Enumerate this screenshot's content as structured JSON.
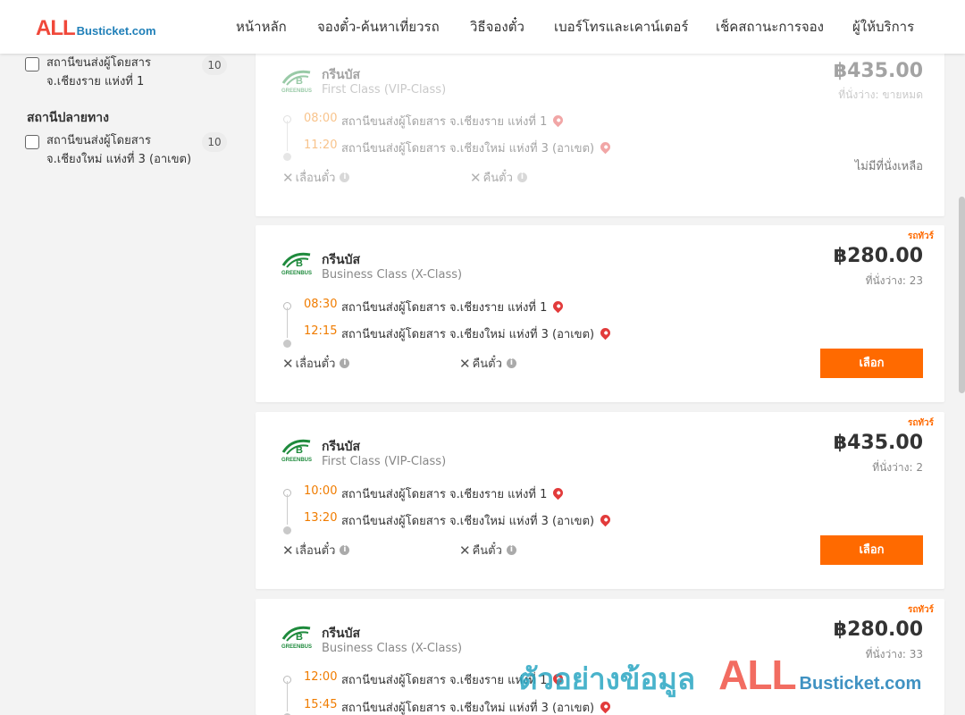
{
  "header": {
    "logo_all": "ALL",
    "logo_busticket": "Busticket.com",
    "nav": [
      "หน้าหลัก",
      "จองตั๋ว-ค้นหาเที่ยวรถ",
      "วิธีจองตั๋ว",
      "เบอร์โทรและเคาน์เตอร์",
      "เช็คสถานะการจอง",
      "ผู้ให้บริการ"
    ]
  },
  "sidebar": {
    "origin_item": {
      "label": "สถานีขนส่งผู้โดยสาร จ.เชียงราย แห่งที่ 1",
      "count": "10"
    },
    "destination_title": "สถานีปลายทาง",
    "destination_item": {
      "label": "สถานีขนส่งผู้โดยสาร จ.เชียงใหม่ แห่งที่ 3 (อาเขต)",
      "count": "10"
    }
  },
  "labels": {
    "postpone": "เลื่อนตั๋ว",
    "refund": "คืนตั๋ว",
    "select": "เลือก",
    "promo": "รถทัวร์",
    "no_seats": "ไม่มีที่นั่งเหลือ"
  },
  "trips": [
    {
      "operator": "กรีนบัส",
      "class": "First Class (VIP-Class)",
      "price": "฿435.00",
      "seats": "ที่นั่งว่าง: ขายหมด",
      "depart_time": "08:00",
      "depart_station": "สถานีขนส่งผู้โดยสาร จ.เชียงราย แห่งที่ 1",
      "arrive_time": "11:20",
      "arrive_station": "สถานีขนส่งผู้โดยสาร จ.เชียงใหม่ แห่งที่ 3 (อาเขต)",
      "sold_out": true
    },
    {
      "operator": "กรีนบัส",
      "class": "Business Class (X-Class)",
      "price": "฿280.00",
      "seats": "ที่นั่งว่าง: 23",
      "depart_time": "08:30",
      "depart_station": "สถานีขนส่งผู้โดยสาร จ.เชียงราย แห่งที่ 1",
      "arrive_time": "12:15",
      "arrive_station": "สถานีขนส่งผู้โดยสาร จ.เชียงใหม่ แห่งที่ 3 (อาเขต)",
      "sold_out": false
    },
    {
      "operator": "กรีนบัส",
      "class": "First Class (VIP-Class)",
      "price": "฿435.00",
      "seats": "ที่นั่งว่าง: 2",
      "depart_time": "10:00",
      "depart_station": "สถานีขนส่งผู้โดยสาร จ.เชียงราย แห่งที่ 1",
      "arrive_time": "13:20",
      "arrive_station": "สถานีขนส่งผู้โดยสาร จ.เชียงใหม่ แห่งที่ 3 (อาเขต)",
      "sold_out": false
    },
    {
      "operator": "กรีนบัส",
      "class": "Business Class (X-Class)",
      "price": "฿280.00",
      "seats": "ที่นั่งว่าง: 33",
      "depart_time": "12:00",
      "depart_station": "สถานีขนส่งผู้โดยสาร จ.เชียงราย แห่งที่ 1",
      "arrive_time": "15:45",
      "arrive_station": "สถานีขนส่งผู้โดยสาร จ.เชียงใหม่ แห่งที่ 3 (อาเขต)",
      "sold_out": false
    }
  ],
  "watermark": {
    "thai": "ตัวอย่างข้อมูล",
    "all": "ALL",
    "busticket": "Busticket.com"
  },
  "colors": {
    "accent_orange": "#ff6a00",
    "time_orange": "#f07c00",
    "logo_red": "#f0483a",
    "logo_blue": "#1f7fb8",
    "operator_green": "#1e8a3c"
  }
}
